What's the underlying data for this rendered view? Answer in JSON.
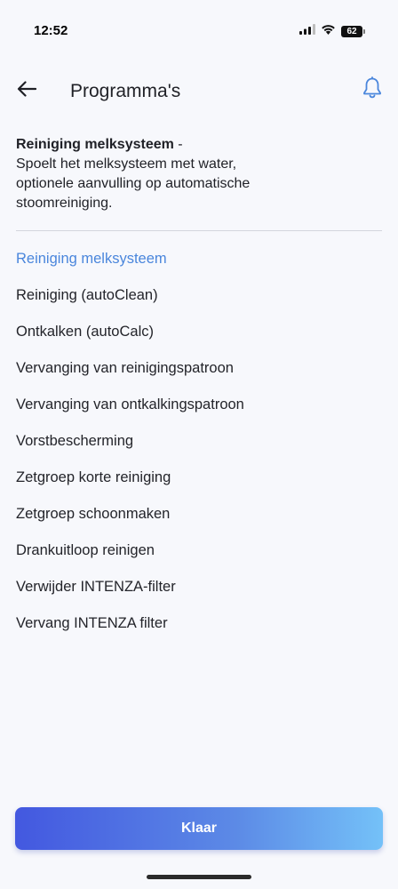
{
  "status_bar": {
    "time": "12:52",
    "battery": "62",
    "icons": [
      "signal-icon",
      "wifi-icon",
      "battery-icon"
    ]
  },
  "header": {
    "title": "Programma's",
    "back_icon": "arrow-left-icon",
    "bell_icon": "bell-icon"
  },
  "description": {
    "title": "Reiniging melksysteem",
    "separator": " -",
    "text": "Spoelt het melksysteem met water, optionele aanvulling op automatische stoomreiniging."
  },
  "programs": [
    {
      "label": "Reiniging melksysteem",
      "selected": true
    },
    {
      "label": "Reiniging (autoClean)",
      "selected": false
    },
    {
      "label": "Ontkalken (autoCalc)",
      "selected": false
    },
    {
      "label": "Vervanging van reinigingspatroon",
      "selected": false
    },
    {
      "label": "Vervanging van ontkalkingspatroon",
      "selected": false
    },
    {
      "label": "Vorstbescherming",
      "selected": false
    },
    {
      "label": "Zetgroep korte reiniging",
      "selected": false
    },
    {
      "label": "Zetgroep schoonmaken",
      "selected": false
    },
    {
      "label": "Drankuitloop reinigen",
      "selected": false
    },
    {
      "label": "Verwijder INTENZA-filter",
      "selected": false
    },
    {
      "label": "Vervang INTENZA filter",
      "selected": false
    }
  ],
  "done_button": {
    "label": "Klaar"
  },
  "colors": {
    "accent": "#4a86dc",
    "background": "#f7f8fc",
    "text": "#1f2026",
    "button_gradient_start": "#4358e0",
    "button_gradient_end": "#74c1f8"
  }
}
